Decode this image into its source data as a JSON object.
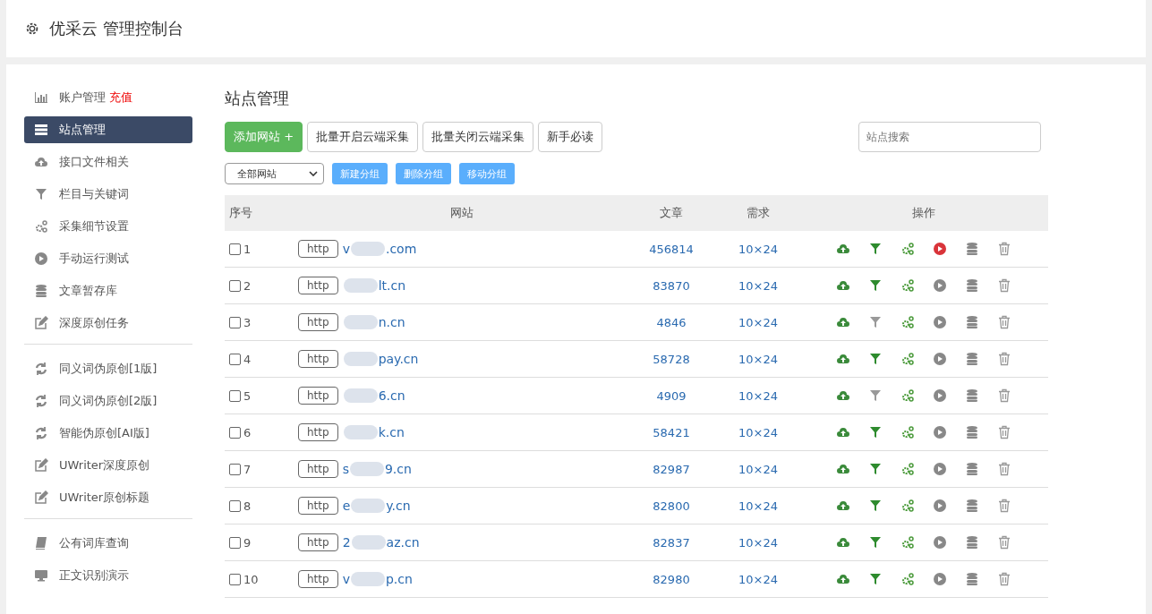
{
  "header": {
    "title": "优采云 管理控制台"
  },
  "sidebar": {
    "groups": [
      [
        {
          "label": "账户管理",
          "extra": "充值",
          "selected": false
        },
        {
          "label": "站点管理",
          "selected": true
        },
        {
          "label": "接口文件相关",
          "selected": false
        },
        {
          "label": "栏目与关键词",
          "selected": false
        },
        {
          "label": "采集细节设置",
          "selected": false
        },
        {
          "label": "手动运行测试",
          "selected": false
        },
        {
          "label": "文章暂存库",
          "selected": false
        },
        {
          "label": "深度原创任务",
          "selected": false
        }
      ],
      [
        {
          "label": "同义词伪原创[1版]",
          "selected": false
        },
        {
          "label": "同义词伪原创[2版]",
          "selected": false
        },
        {
          "label": "智能伪原创[AI版]",
          "selected": false
        },
        {
          "label": "UWriter深度原创",
          "selected": false
        },
        {
          "label": "UWriter原创标题",
          "selected": false
        }
      ],
      [
        {
          "label": "公有词库查询",
          "selected": false
        },
        {
          "label": "正文识别演示",
          "selected": false
        }
      ]
    ]
  },
  "main": {
    "title": "站点管理",
    "buttons": [
      {
        "kind": "primary",
        "label": "添加网站 +"
      },
      {
        "kind": "default",
        "label": "批量开启云端采集"
      },
      {
        "kind": "default",
        "label": "批量关闭云端采集"
      },
      {
        "kind": "default",
        "label": "新手必读"
      }
    ],
    "search": {
      "placeholder": "站点搜索"
    },
    "group_select": {
      "value": "全部网站"
    },
    "group_buttons": [
      "新建分组",
      "删除分组",
      "移动分组"
    ],
    "table": {
      "columns": [
        "序号",
        "网站",
        "文章",
        "需求",
        "操作"
      ],
      "rows": [
        {
          "no": "1",
          "checked": false,
          "protocol": "http",
          "site_start": "v",
          "site_end": ".com",
          "articles": "456814",
          "demand": "10×24",
          "filter_on": true,
          "running": true
        },
        {
          "no": "2",
          "checked": false,
          "protocol": "http",
          "site_end": "lt.cn",
          "articles": "83870",
          "demand": "10×24",
          "filter_on": true,
          "running": false
        },
        {
          "no": "3",
          "checked": false,
          "protocol": "http",
          "site_end": "n.cn",
          "articles": "4846",
          "demand": "10×24",
          "filter_on": false,
          "running": false
        },
        {
          "no": "4",
          "checked": false,
          "protocol": "http",
          "site_end": "pay.cn",
          "articles": "58728",
          "demand": "10×24",
          "filter_on": true,
          "running": false
        },
        {
          "no": "5",
          "checked": false,
          "protocol": "http",
          "site_end": "6.cn",
          "articles": "4909",
          "demand": "10×24",
          "filter_on": false,
          "running": false
        },
        {
          "no": "6",
          "checked": false,
          "protocol": "http",
          "site_end": "k.cn",
          "articles": "58421",
          "demand": "10×24",
          "filter_on": true,
          "running": false
        },
        {
          "no": "7",
          "checked": false,
          "protocol": "http",
          "site_start": "s",
          "site_end": "9.cn",
          "articles": "82987",
          "demand": "10×24",
          "filter_on": true,
          "running": false
        },
        {
          "no": "8",
          "checked": false,
          "protocol": "http",
          "site_start": "e",
          "site_end": "y.cn",
          "articles": "82800",
          "demand": "10×24",
          "filter_on": true,
          "running": false
        },
        {
          "no": "9",
          "checked": false,
          "protocol": "http",
          "site_start": "2",
          "site_end": "az.cn",
          "articles": "82837",
          "demand": "10×24",
          "filter_on": true,
          "running": false
        },
        {
          "no": "10",
          "checked": false,
          "protocol": "http",
          "site_start": "v",
          "site_end": "p.cn",
          "articles": "82980",
          "demand": "10×24",
          "filter_on": true,
          "running": false
        }
      ]
    }
  }
}
